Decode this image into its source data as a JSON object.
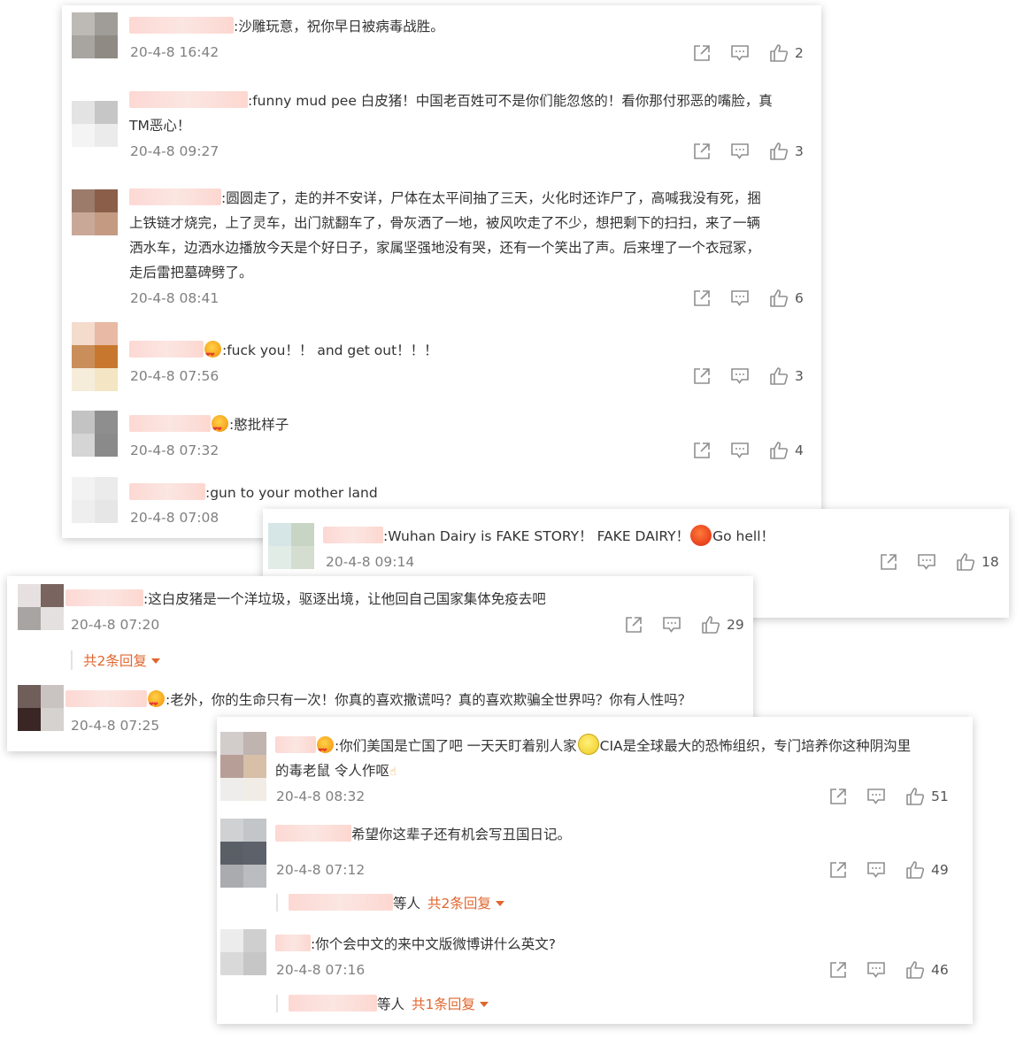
{
  "colors": {
    "link_orange": "#e0662e",
    "timestamp_gray": "#808080",
    "text": "#333333",
    "icon_gray": "#8f8f8f"
  },
  "icons": {
    "share": "share-icon",
    "comment": "comment-icon",
    "like": "like-icon"
  },
  "panels": [
    {
      "comments": [
        {
          "text": ":沙雕玩意，祝你早日被病毒战胜。",
          "time": "20-4-8 16:42",
          "likes": "2"
        },
        {
          "text_line1": ":funny mud pee 白皮猪！中国老百姓可不是你们能忽悠的！看你那付邪恶的嘴脸，真",
          "text_line2": "TM恶心！",
          "time": "20-4-8 09:27",
          "likes": "3"
        },
        {
          "text_line1": ":圆圆走了，走的并不安详，尸体在太平间抽了三天，火化时还诈尸了，高喊我没有死，捆",
          "text_line2": "上铁链才烧完，上了灵车，出门就翻车了，骨灰洒了一地，被风吹走了不少，想把剩下的扫扫，来了一辆",
          "text_line3": "洒水车，边洒水边播放今天是个好日子，家属坚强地没有哭，还有一个笑出了声。后来埋了一个衣冠冢，",
          "text_line4": "走后雷把墓碑劈了。",
          "time": "20-4-8 08:41",
          "likes": "6"
        },
        {
          "text": ":fuck you！！ and  get out！！！",
          "time": "20-4-8 07:56",
          "likes": "3"
        },
        {
          "text": ":憨批样子",
          "time": "20-4-8 07:32",
          "likes": "4"
        },
        {
          "text": ":gun to your mother land",
          "time": "20-4-8 07:08"
        }
      ]
    },
    {
      "comments": [
        {
          "text_a": ":Wuhan Dairy is FAKE STORY！ FAKE DAIRY！",
          "text_b": "Go hell！",
          "time": "20-4-8 09:14",
          "likes": "18"
        }
      ]
    },
    {
      "comments": [
        {
          "text": ":这白皮猪是一个洋垃圾，驱逐出境，让他回自己国家集体免疫去吧",
          "time": "20-4-8 07:20",
          "likes": "29",
          "replies_label": "共2条回复"
        },
        {
          "text": ":老外，你的生命只有一次！你真的喜欢撒谎吗？真的喜欢欺骗全世界吗？你有人性吗？",
          "time": "20-4-8 07:25"
        }
      ]
    },
    {
      "comments": [
        {
          "text_a": ":你们美国是亡国了吧  一天天盯着别人家",
          "text_b": "CIA是全球最大的恐怖组织，专门培养你这种阴沟里",
          "text_line2": "的毒老鼠 令人作呕",
          "time": "20-4-8 08:32",
          "likes": "51"
        },
        {
          "text": "希望你这辈子还有机会写丑国日记。",
          "time": "20-4-8 07:12",
          "likes": "49",
          "sub_suffix": "等人",
          "replies_label": "共2条回复"
        },
        {
          "text": ":你个会中文的来中文版微博讲什么英文?",
          "time": "20-4-8 07:16",
          "likes": "46",
          "sub_suffix": "等人",
          "replies_label": "共1条回复"
        }
      ]
    }
  ]
}
